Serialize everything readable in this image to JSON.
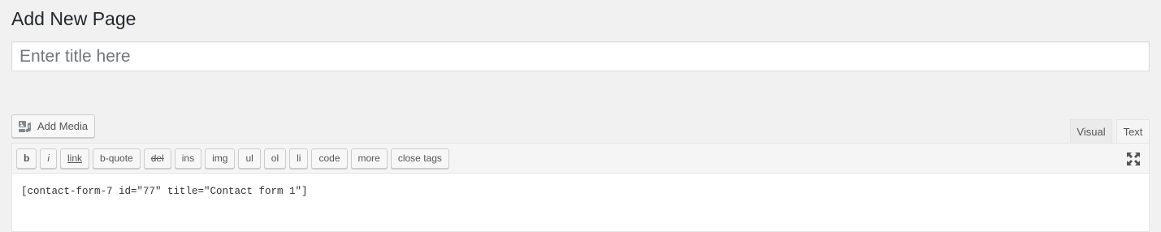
{
  "page": {
    "title": "Add New Page"
  },
  "title_field": {
    "placeholder": "Enter title here",
    "value": ""
  },
  "media": {
    "add_media_label": "Add Media",
    "icon": "add-media-icon"
  },
  "editor_tabs": {
    "visual": "Visual",
    "text": "Text",
    "active": "text"
  },
  "quicktags": {
    "b": "b",
    "i": "i",
    "link": "link",
    "bquote": "b-quote",
    "del": "del",
    "ins": "ins",
    "img": "img",
    "ul": "ul",
    "ol": "ol",
    "li": "li",
    "code": "code",
    "more": "more",
    "close_tags": "close tags",
    "fullscreen_icon": "fullscreen-icon"
  },
  "editor": {
    "content": "[contact-form-7 id=\"77\" title=\"Contact form 1\"]"
  }
}
